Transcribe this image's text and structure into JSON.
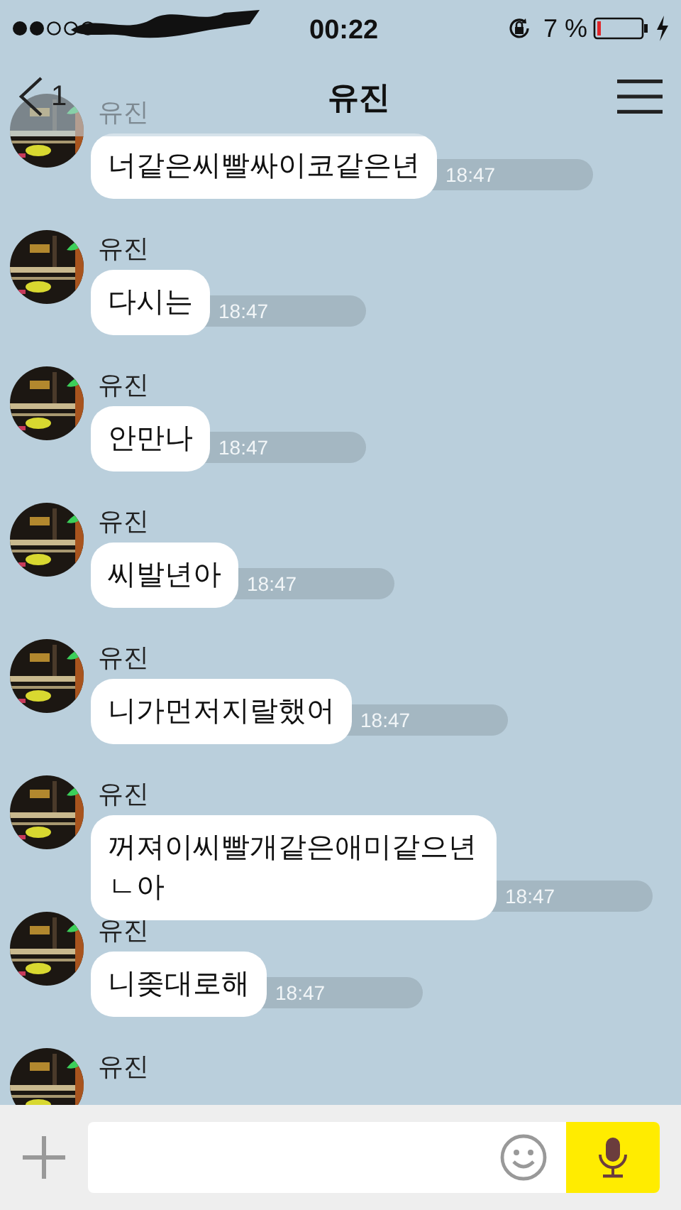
{
  "status_bar": {
    "time": "00:22",
    "battery": "7 %",
    "charging": true
  },
  "header": {
    "back_count": "1",
    "title": "유진"
  },
  "messages": [
    {
      "sender": "유진",
      "text": "너같은씨빨싸이코같은년",
      "time": "18:47"
    },
    {
      "sender": "유진",
      "text": "다시는",
      "time": "18:47"
    },
    {
      "sender": "유진",
      "text": "안만나",
      "time": "18:47"
    },
    {
      "sender": "유진",
      "text": "씨발년아",
      "time": "18:47"
    },
    {
      "sender": "유진",
      "text": "니가먼저지랄했어",
      "time": "18:47"
    },
    {
      "sender": "유진",
      "text": "꺼져이씨빨개같은애미같으년ㄴ아",
      "time": "18:47"
    },
    {
      "sender": "유진",
      "text": "니좆대로해",
      "time": "18:47"
    },
    {
      "sender": "유진"
    }
  ]
}
